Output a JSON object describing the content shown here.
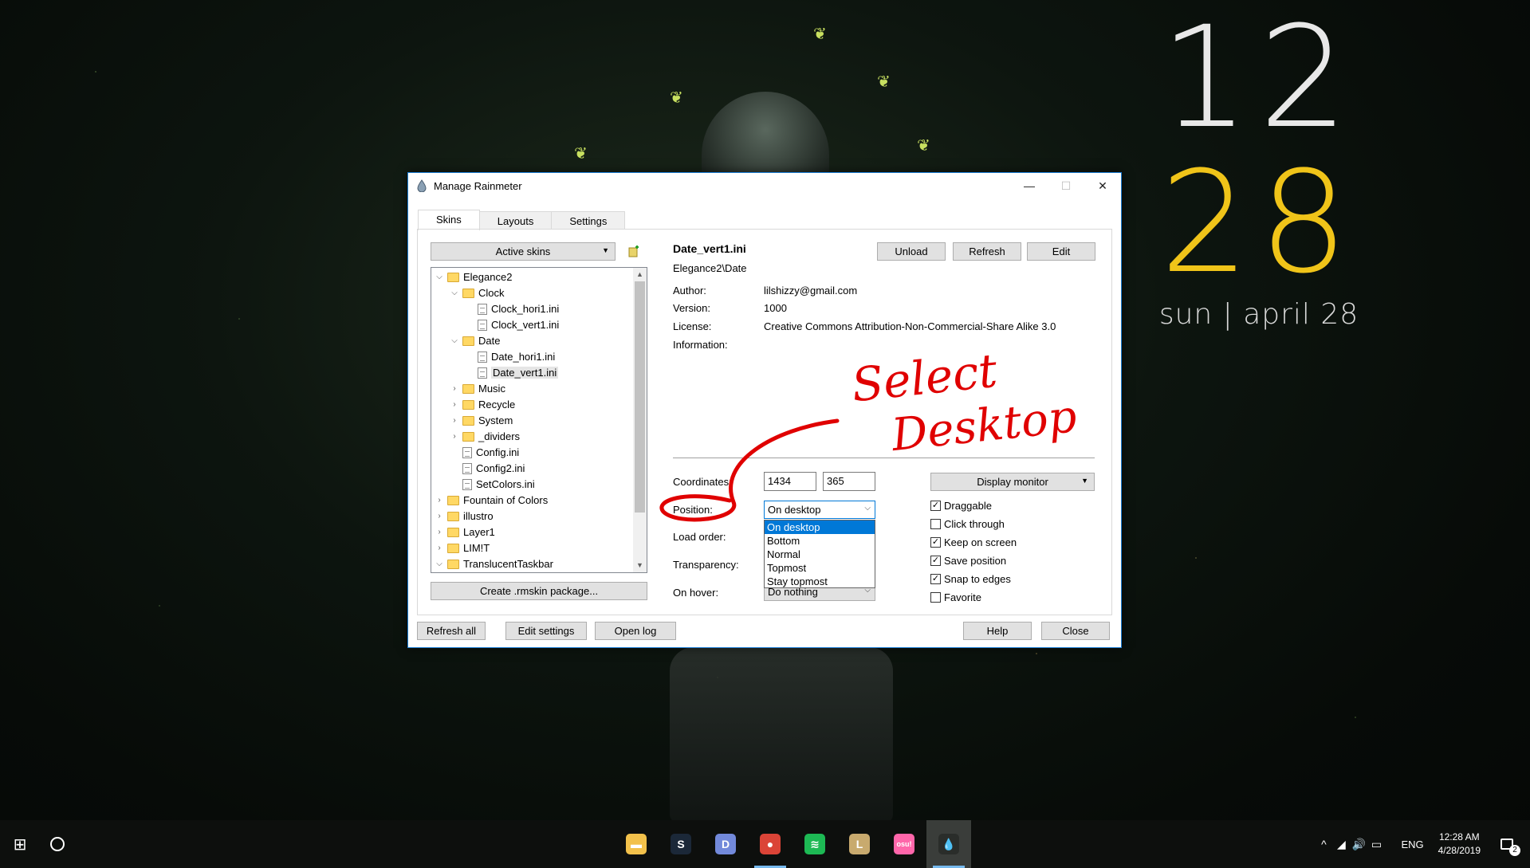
{
  "desktop": {
    "clock": {
      "hour": "12",
      "minute": "28",
      "date": "sun | april 28"
    },
    "annotation": {
      "line1": "Select",
      "line2": "Desktop"
    }
  },
  "window": {
    "title": "Manage Rainmeter",
    "controls": {
      "minimize": "—",
      "maximize": "☐",
      "close": "✕"
    },
    "tabs": [
      {
        "label": "Skins"
      },
      {
        "label": "Layouts"
      },
      {
        "label": "Settings"
      }
    ],
    "active_skins_label": "Active skins",
    "tree": [
      {
        "label": "Elegance2",
        "type": "folder",
        "expand": "⌵"
      },
      {
        "label": "Clock",
        "type": "folder",
        "expand": "⌵"
      },
      {
        "label": "Clock_hori1.ini",
        "type": "file",
        "expand": ""
      },
      {
        "label": "Clock_vert1.ini",
        "type": "file",
        "expand": ""
      },
      {
        "label": "Date",
        "type": "folder",
        "expand": "⌵"
      },
      {
        "label": "Date_hori1.ini",
        "type": "file",
        "expand": ""
      },
      {
        "label": "Date_vert1.ini",
        "type": "file",
        "expand": ""
      },
      {
        "label": "Music",
        "type": "folder",
        "expand": "›"
      },
      {
        "label": "Recycle",
        "type": "folder",
        "expand": "›"
      },
      {
        "label": "System",
        "type": "folder",
        "expand": "›"
      },
      {
        "label": "_dividers",
        "type": "folder",
        "expand": "›"
      },
      {
        "label": "Config.ini",
        "type": "file",
        "expand": ""
      },
      {
        "label": "Config2.ini",
        "type": "file",
        "expand": ""
      },
      {
        "label": "SetColors.ini",
        "type": "file",
        "expand": ""
      },
      {
        "label": "Fountain of Colors",
        "type": "folder",
        "expand": "›"
      },
      {
        "label": "illustro",
        "type": "folder",
        "expand": "›"
      },
      {
        "label": "Layer1",
        "type": "folder",
        "expand": "›"
      },
      {
        "label": "LIM!T",
        "type": "folder",
        "expand": "›"
      },
      {
        "label": "TranslucentTaskbar",
        "type": "folder",
        "expand": "⌵"
      }
    ],
    "create_package": "Create .rmskin package...",
    "skin": {
      "name": "Date_vert1.ini",
      "path": "Elegance2\\Date",
      "author_label": "Author:",
      "author": "lilshizzy@gmail.com",
      "version_label": "Version:",
      "version": "1000",
      "license_label": "License:",
      "license": "Creative Commons Attribution-Non-Commercial-Share Alike 3.0",
      "information_label": "Information:"
    },
    "skin_buttons": {
      "unload": "Unload",
      "refresh": "Refresh",
      "edit": "Edit"
    },
    "settings": {
      "coordinates_label": "Coordinates:",
      "x": "1434",
      "y": "365",
      "position_label": "Position:",
      "position_value": "On desktop",
      "position_options": [
        "On desktop",
        "Bottom",
        "Normal",
        "Topmost",
        "Stay topmost"
      ],
      "load_order_label": "Load order:",
      "transparency_label": "Transparency:",
      "on_hover_label": "On hover:",
      "on_hover_value": "Do nothing",
      "display_monitor": "Display monitor"
    },
    "checkboxes": [
      {
        "label": "Draggable",
        "checked": "✓"
      },
      {
        "label": "Click through",
        "checked": ""
      },
      {
        "label": "Keep on screen",
        "checked": "✓"
      },
      {
        "label": "Save position",
        "checked": "✓"
      },
      {
        "label": "Snap to edges",
        "checked": "✓"
      },
      {
        "label": "Favorite",
        "checked": ""
      }
    ],
    "footer": {
      "refresh_all": "Refresh all",
      "edit_settings": "Edit settings",
      "open_log": "Open log",
      "help": "Help",
      "close": "Close"
    }
  },
  "taskbar": {
    "start_icon": "⊞",
    "apps": [
      {
        "name": "file-explorer-icon",
        "glyph": "▬",
        "color": "#f2c14b"
      },
      {
        "name": "steam-icon",
        "glyph": "S",
        "color": "#1b2838"
      },
      {
        "name": "discord-icon",
        "glyph": "D",
        "color": "#7289da"
      },
      {
        "name": "chrome-icon",
        "glyph": "●",
        "color": "#db4437"
      },
      {
        "name": "spotify-icon",
        "glyph": "≋",
        "color": "#1db954"
      },
      {
        "name": "league-icon",
        "glyph": "L",
        "color": "#c8aa6e"
      },
      {
        "name": "osu-icon",
        "glyph": "osu!",
        "color": "#ff66aa"
      },
      {
        "name": "rainmeter-icon",
        "glyph": "💧",
        "color": "#2a2d2a"
      }
    ],
    "tray": {
      "chevron": "^",
      "network": "◢",
      "volume": "🔊",
      "battery": "▭",
      "language": "ENG",
      "time": "12:28 AM",
      "date": "4/28/2019",
      "notification_count": "2"
    }
  }
}
